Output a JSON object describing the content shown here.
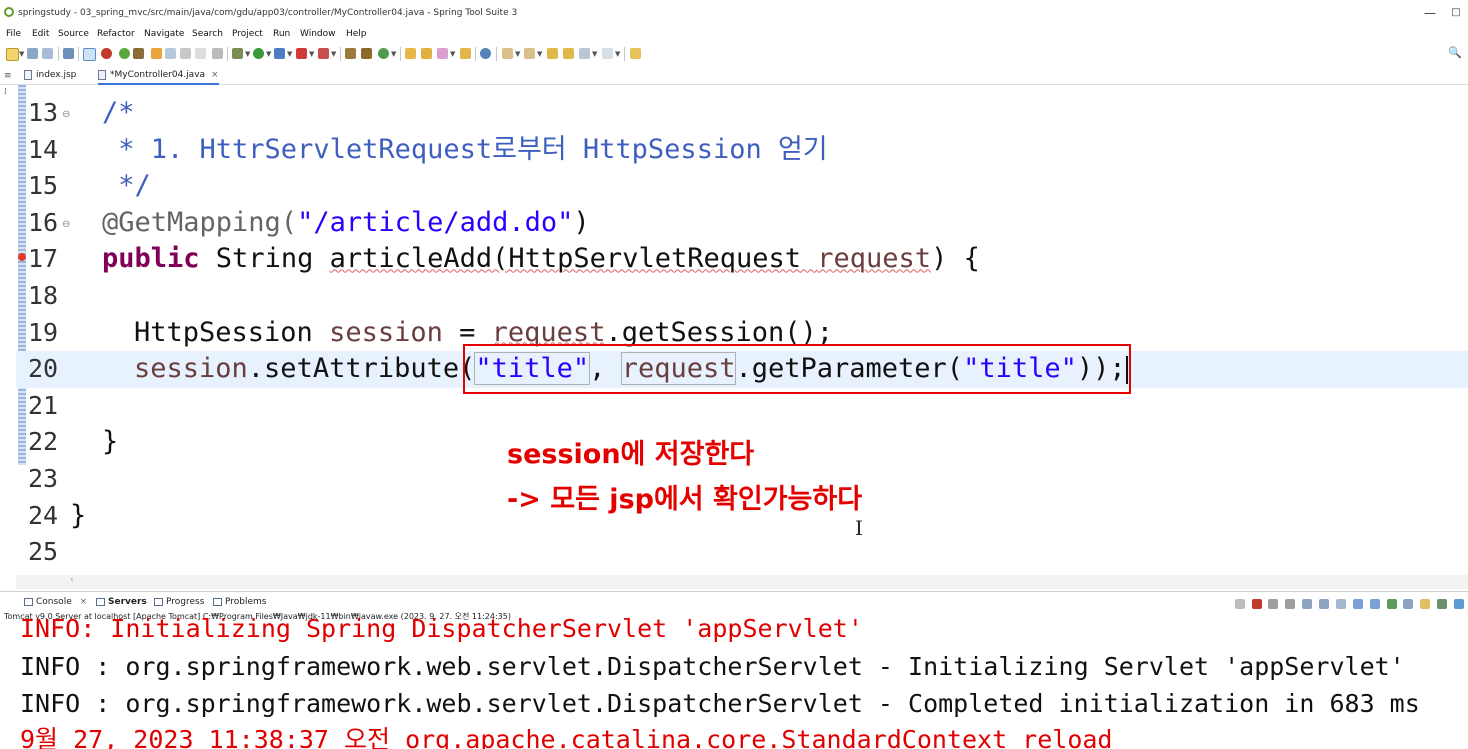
{
  "window": {
    "title": "springstudy - 03_spring_mvc/src/main/java/com/gdu/app03/controller/MyController04.java - Spring Tool Suite 3",
    "minimize_glyph": "—",
    "maximize_glyph": "□"
  },
  "menu": [
    "File",
    "Edit",
    "Source",
    "Refactor",
    "Navigate",
    "Search",
    "Project",
    "Run",
    "Window",
    "Help"
  ],
  "tabs": [
    {
      "label": "index.jsp",
      "active": false
    },
    {
      "label": "*MyController04.java",
      "active": true,
      "close": "×"
    }
  ],
  "editor": {
    "lines": [
      {
        "num": "13",
        "fold": "⊖"
      },
      {
        "num": "14"
      },
      {
        "num": "15"
      },
      {
        "num": "16",
        "fold": "⊖"
      },
      {
        "num": "17"
      },
      {
        "num": "18"
      },
      {
        "num": "19"
      },
      {
        "num": "20"
      },
      {
        "num": "21"
      },
      {
        "num": "22"
      },
      {
        "num": "23"
      },
      {
        "num": "24"
      },
      {
        "num": "25"
      }
    ],
    "code": {
      "l13": "/*",
      "l14": " * 1. HttrServletRequest로부터 HttpSession 얻기",
      "l15": " */",
      "l16_ann": "@GetMapping(",
      "l16_str": "\"/article/add.do\"",
      "l16_end": ")",
      "l17_kw": "public",
      "l17_type": " String ",
      "l17_method": "articleAdd(HttpServletRequest ",
      "l17_param": "request",
      "l17_end": ") {",
      "l19_type": "HttpSession ",
      "l19_var": "session",
      "l19_eq": " = ",
      "l19_req": "request",
      "l19_call": ".getSession();",
      "l20_var": "session",
      "l20_call": ".setAttribute(",
      "l20_str1": "\"title\"",
      "l20_comma": ", ",
      "l20_req": "request",
      "l20_get": ".getParameter(",
      "l20_str2": "\"title\"",
      "l20_end": "));",
      "l22": "}",
      "l24": "}"
    },
    "notes": {
      "line1": "session에 저장한다",
      "line2": "-> 모든 jsp에서 확인가능하다"
    },
    "colors": {
      "note": "#e50000",
      "keyword": "#7f0055",
      "string": "#2a00ff",
      "comment": "#3f5fbf",
      "annotation": "#646464"
    }
  },
  "console": {
    "tabs": [
      {
        "label": "Console",
        "close": "×"
      },
      {
        "label": "Servers"
      },
      {
        "label": "Progress"
      },
      {
        "label": "Problems"
      }
    ],
    "description": "Tomcat v9.0 Server at localhost [Apache Tomcat] C:₩Program Files₩Java₩jdk-11₩bin₩javaw.exe  (2023. 9. 27. 오전 11:24:35)",
    "lines": [
      {
        "text": "INFO: Initializing Spring DispatcherServlet 'appServlet'",
        "color": "red"
      },
      {
        "text": "INFO : org.springframework.web.servlet.DispatcherServlet - Initializing Servlet 'appServlet'",
        "color": "black"
      },
      {
        "text": "INFO : org.springframework.web.servlet.DispatcherServlet - Completed initialization in 683 ms",
        "color": "black"
      },
      {
        "text": "9월 27, 2023 11:38:37 오전 org.apache.catalina.core.StandardContext reload",
        "color": "red"
      }
    ]
  }
}
